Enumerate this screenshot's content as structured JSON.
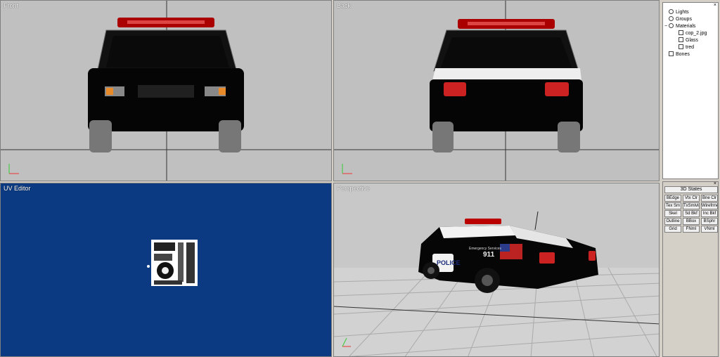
{
  "viewports": {
    "front": {
      "label": "Front"
    },
    "back": {
      "label": "Back"
    },
    "uv": {
      "label": "UV Editor"
    },
    "perspective": {
      "label": "Perspective"
    }
  },
  "scene_tree": {
    "close": "×",
    "items": [
      {
        "label": "Lights",
        "icon": "light-icon"
      },
      {
        "label": "Groups",
        "icon": "group-icon"
      },
      {
        "label": "Materials",
        "icon": "material-icon",
        "expanded": true
      },
      {
        "label": "cop_2.jpg",
        "icon": "texture-icon"
      },
      {
        "label": "Glass",
        "icon": "texture-icon"
      },
      {
        "label": "tred",
        "icon": "texture-icon"
      },
      {
        "label": "Bones",
        "icon": "bone-icon"
      }
    ]
  },
  "states_panel": {
    "close": "×",
    "title": "3D States",
    "buttons": [
      "BEdge",
      "Vtx Clr",
      "Bne Clr",
      "Tex Sm",
      "TxSmlvlr",
      "Wirefrme",
      "Skel",
      "Sd Bkf",
      "Inc Bkf",
      "Outline",
      "BBox",
      "BSphr",
      "Grid",
      "FNmI",
      "VNmI"
    ]
  },
  "car_texts": {
    "police": "POLICE",
    "number": "911",
    "services": "Emergency Services"
  }
}
